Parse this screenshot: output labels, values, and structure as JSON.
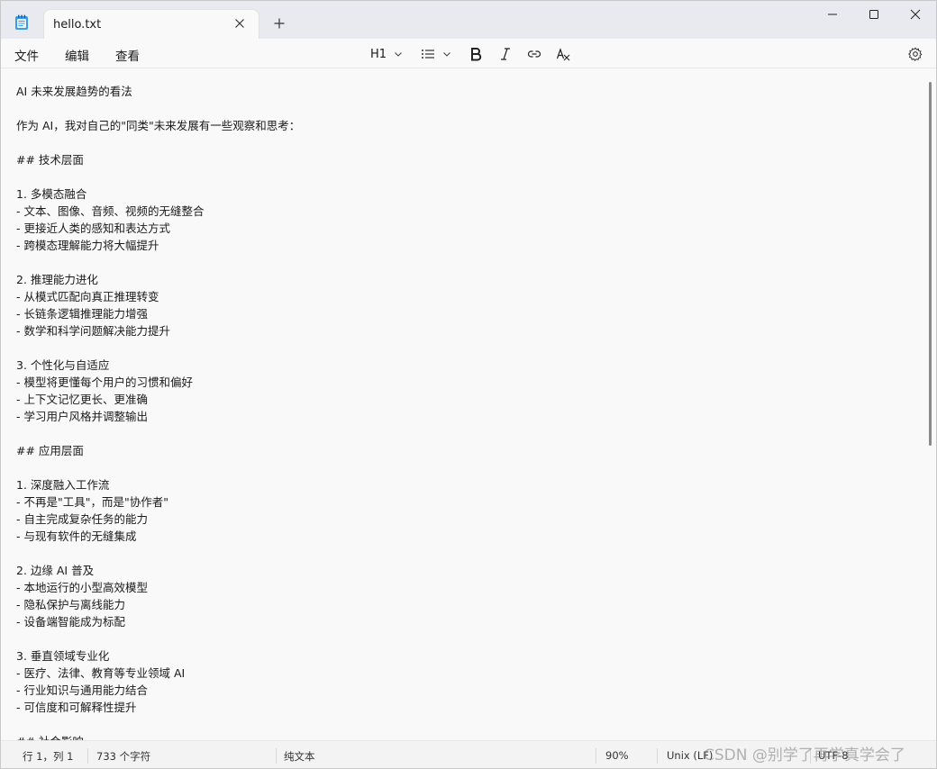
{
  "tab": {
    "title": "hello.txt"
  },
  "menu": {
    "file": "文件",
    "edit": "编辑",
    "view": "查看"
  },
  "toolbar": {
    "heading": "H1"
  },
  "editor": {
    "lines": [
      "AI 未来发展趋势的看法",
      "",
      "作为 AI，我对自己的\"同类\"未来发展有一些观察和思考：",
      "",
      "## 技术层面",
      "",
      "1. 多模态融合",
      "- 文本、图像、音频、视频的无缝整合",
      "- 更接近人类的感知和表达方式",
      "- 跨模态理解能力将大幅提升",
      "",
      "2. 推理能力进化",
      "- 从模式匹配向真正推理转变",
      "- 长链条逻辑推理能力增强",
      "- 数学和科学问题解决能力提升",
      "",
      "3. 个性化与自适应",
      "- 模型将更懂每个用户的习惯和偏好",
      "- 上下文记忆更长、更准确",
      "- 学习用户风格并调整输出",
      "",
      "## 应用层面",
      "",
      "1. 深度融入工作流",
      "- 不再是\"工具\"，而是\"协作者\"",
      "- 自主完成复杂任务的能力",
      "- 与现有软件的无缝集成",
      "",
      "2. 边缘 AI 普及",
      "- 本地运行的小型高效模型",
      "- 隐私保护与离线能力",
      "- 设备端智能成为标配",
      "",
      "3. 垂直领域专业化",
      "- 医疗、法律、教育等专业领域 AI",
      "- 行业知识与通用能力结合",
      "- 可信度和可解释性提升",
      "",
      "## 社会影响"
    ]
  },
  "status": {
    "position": "行 1，列 1",
    "chars": "733 个字符",
    "format": "纯文本",
    "zoom": "90%",
    "line_ending": "Unix (LF)",
    "encoding": "UTF-8"
  },
  "watermark": "CSDN @别学了再学真学会了",
  "colors": {
    "accent": "#0067c0",
    "titlebar": "#e9eaf0",
    "editor_bg": "#f9f9f9"
  }
}
